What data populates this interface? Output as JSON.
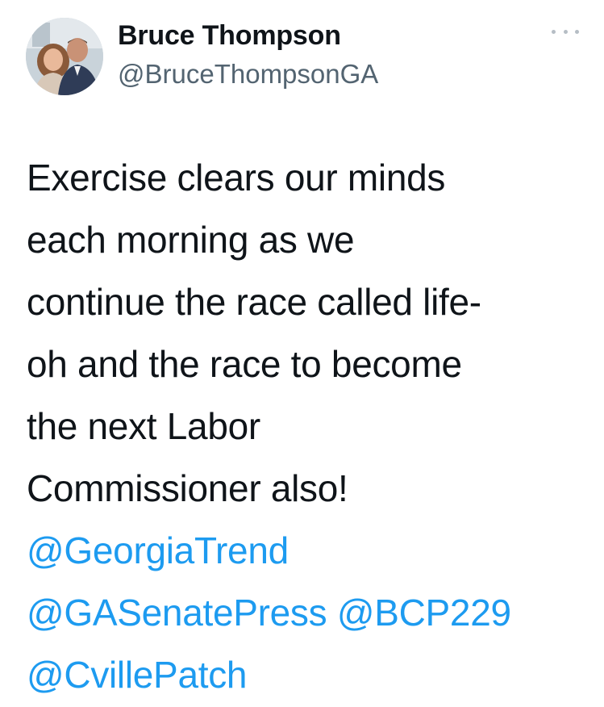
{
  "author": {
    "display_name": "Bruce Thompson",
    "handle": "@BruceThompsonGA",
    "avatar_icon": "profile-photo"
  },
  "more_icon": "ellipsis-icon",
  "tweet": {
    "lines": [
      "Exercise clears our minds",
      "each morning as we",
      "continue the race called life-",
      "oh and the race to become",
      "the next Labor",
      "Commissioner also!"
    ],
    "mentions": {
      "m1": "@GeorgiaTrend",
      "m2": "@GASenatePress",
      "m3": "@BCP229",
      "m4": "@CvillePatch"
    }
  },
  "colors": {
    "text": "#0f1419",
    "secondary": "#536471",
    "link": "#1d9bf0"
  }
}
